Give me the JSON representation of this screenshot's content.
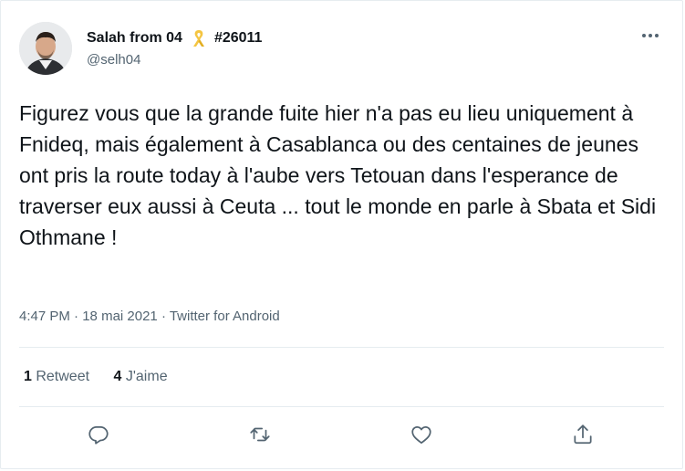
{
  "tweet": {
    "display_name": "Salah from 04",
    "tag": "#26011",
    "handle": "@selh04",
    "text": "Figurez vous que la grande fuite hier n'a pas eu lieu uniquement à Fnideq, mais également à Casablanca ou des centaines de jeunes ont pris la route today à l'aube vers Tetouan dans l'esperance de traverser eux aussi à Ceuta ... tout le monde en parle à Sbata et Sidi Othmane !",
    "time": "4:47 PM",
    "separator": " · ",
    "date": "18 mai 2021",
    "source": "Twitter for Android"
  },
  "stats": {
    "retweets_count": "1",
    "retweets_label": " Retweet",
    "likes_count": "4",
    "likes_label": " J'aime"
  },
  "icons": {
    "more": "more-dots-icon",
    "ribbon": "yellow-ribbon-icon",
    "reply": "reply-icon",
    "retweet": "retweet-icon",
    "like": "heart-icon",
    "share": "share-icon"
  },
  "colors": {
    "text": "#0f1419",
    "secondary": "#536471",
    "ribbon": "#f4c542",
    "divider": "#e6ecf0"
  }
}
